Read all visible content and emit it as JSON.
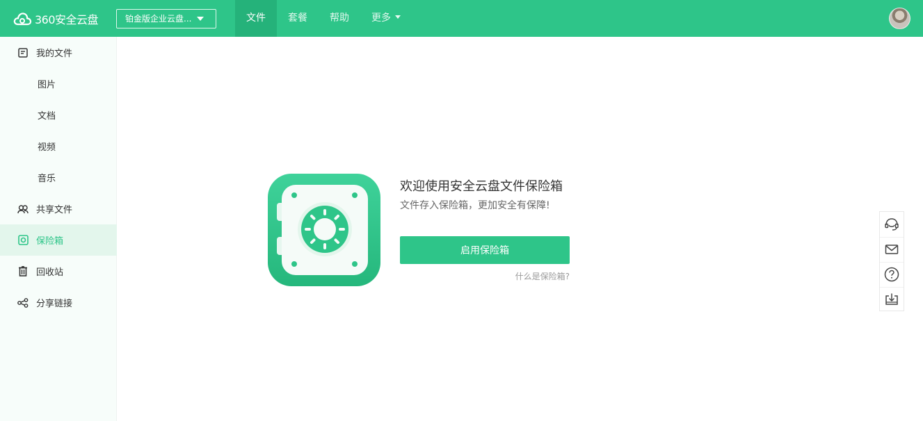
{
  "header": {
    "logo_text": "360安全云盘",
    "plan_select": "铂金版企业云盘...",
    "nav": [
      {
        "label": "文件",
        "active": true
      },
      {
        "label": "套餐",
        "active": false
      },
      {
        "label": "帮助",
        "active": false
      },
      {
        "label": "更多",
        "active": false,
        "has_dropdown": true
      }
    ]
  },
  "sidebar": {
    "items": [
      {
        "label": "我的文件",
        "icon": "my-files-icon"
      },
      {
        "label": "图片"
      },
      {
        "label": "文档"
      },
      {
        "label": "视频"
      },
      {
        "label": "音乐"
      },
      {
        "label": "共享文件",
        "icon": "shared-users-icon"
      },
      {
        "label": "保险箱",
        "icon": "safe-icon",
        "active": true
      },
      {
        "label": "回收站",
        "icon": "trash-icon"
      },
      {
        "label": "分享链接",
        "icon": "share-link-icon"
      }
    ]
  },
  "main": {
    "title": "欢迎使用安全云盘文件保险箱",
    "subtitle": "文件存入保险箱，更加安全有保障!",
    "enable_button": "启用保险箱",
    "help_link": "什么是保险箱?"
  },
  "tools": [
    "customer-service-icon",
    "mail-icon",
    "help-circle-icon",
    "download-icon"
  ],
  "colors": {
    "brand": "#2ec589",
    "brand_dark": "#25b27a",
    "sidebar_bg": "#f7fdfa",
    "active_bg": "#e3f6ec"
  }
}
